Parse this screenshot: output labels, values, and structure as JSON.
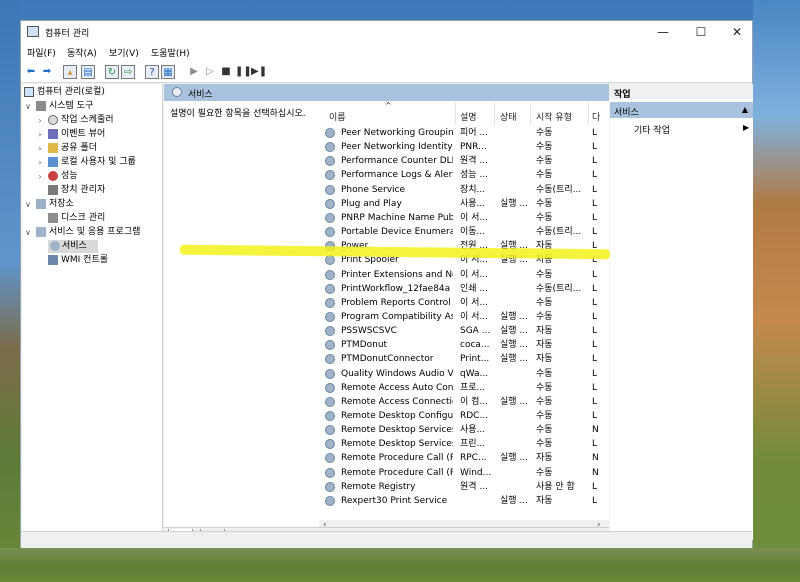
{
  "window": {
    "title": "컴퓨터 관리"
  },
  "menu": [
    "파일(F)",
    "동작(A)",
    "보기(V)",
    "도움말(H)"
  ],
  "tree": [
    {
      "label": "컴퓨터 관리(로컬)",
      "level": 0,
      "tw": ""
    },
    {
      "label": "시스템 도구",
      "level": 1,
      "tw": "∨"
    },
    {
      "label": "작업 스케줄러",
      "level": 2,
      "tw": "›"
    },
    {
      "label": "이벤트 뷰어",
      "level": 2,
      "tw": "›"
    },
    {
      "label": "공유 폴더",
      "level": 2,
      "tw": "›"
    },
    {
      "label": "로컬 사용자 및 그룹",
      "level": 2,
      "tw": "›"
    },
    {
      "label": "성능",
      "level": 2,
      "tw": "›"
    },
    {
      "label": "장치 관리자",
      "level": 2,
      "tw": ""
    },
    {
      "label": "저장소",
      "level": 1,
      "tw": "∨"
    },
    {
      "label": "디스크 관리",
      "level": 2,
      "tw": ""
    },
    {
      "label": "서비스 및 응용 프로그램",
      "level": 1,
      "tw": "∨"
    },
    {
      "label": "서비스",
      "level": 2,
      "tw": "",
      "selected": true
    },
    {
      "label": "WMI 컨트롤",
      "level": 2,
      "tw": ""
    }
  ],
  "services_header": "서비스",
  "description_text": "설명이 필요한 항목을 선택하십시오.",
  "columns": [
    "이름",
    "설명",
    "상태",
    "시작 유형",
    "다"
  ],
  "rows": [
    [
      "Peer Networking Grouping",
      "피어 ...",
      "",
      "수동",
      "L"
    ],
    [
      "Peer Networking Identity ...",
      "PNR...",
      "",
      "수동",
      "L"
    ],
    [
      "Performance Counter DLL ...",
      "원격 ...",
      "",
      "수동",
      "L"
    ],
    [
      "Performance Logs & Alerts",
      "성능 ...",
      "",
      "수동",
      "L"
    ],
    [
      "Phone Service",
      "장치...",
      "",
      "수동(트리...",
      "L"
    ],
    [
      "Plug and Play",
      "사용...",
      "실행 ...",
      "수동",
      "L"
    ],
    [
      "PNRP Machine Name Publi...",
      "이 서...",
      "",
      "수동",
      "L"
    ],
    [
      "Portable Device Enumerato...",
      "이동...",
      "",
      "수동(트리...",
      "L"
    ],
    [
      "Power",
      "전원 ...",
      "실행 ...",
      "자동",
      "L"
    ],
    [
      "Print Spooler",
      "이 서...",
      "실행 ...",
      "자동",
      "L"
    ],
    [
      "Printer Extensions and Noti...",
      "이 서...",
      "",
      "수동",
      "L"
    ],
    [
      "PrintWorkflow_12fae84a",
      "인쇄 ...",
      "",
      "수동(트리...",
      "L"
    ],
    [
      "Problem Reports Control P...",
      "이 서...",
      "",
      "수동",
      "L"
    ],
    [
      "Program Compatibility Assi...",
      "이 서...",
      "실행 ...",
      "수동",
      "L"
    ],
    [
      "PSSWSCSVC",
      "SGA ...",
      "실행 ...",
      "자동",
      "L"
    ],
    [
      "PTMDonut",
      "coca...",
      "실행 ...",
      "자동",
      "L"
    ],
    [
      "PTMDonutConnector",
      "Print...",
      "실행 ...",
      "자동",
      "L"
    ],
    [
      "Quality Windows Audio Vi...",
      "qWa...",
      "",
      "수동",
      "L"
    ],
    [
      "Remote Access Auto Conn...",
      "프로...",
      "",
      "수동",
      "L"
    ],
    [
      "Remote Access Connection...",
      "이 컴...",
      "실행 ...",
      "수동",
      "L"
    ],
    [
      "Remote Desktop Configura...",
      "RDC...",
      "",
      "수동",
      "L"
    ],
    [
      "Remote Desktop Services",
      "사용...",
      "",
      "수동",
      "N"
    ],
    [
      "Remote Desktop Services ...",
      "프린...",
      "",
      "수동",
      "L"
    ],
    [
      "Remote Procedure Call (RP...",
      "RPC...",
      "실행 ...",
      "자동",
      "N"
    ],
    [
      "Remote Procedure Call (RP...",
      "Wind...",
      "",
      "수동",
      "N"
    ],
    [
      "Remote Registry",
      "원격 ...",
      "",
      "사용 안 함",
      "L"
    ],
    [
      "Rexpert30 Print Service",
      "",
      "실행 ...",
      "자동",
      "L"
    ]
  ],
  "bottom_tabs": [
    "확장",
    "표준"
  ],
  "actions": {
    "header": "작업",
    "section": "서비스",
    "item": "기타 작업"
  },
  "colors": {
    "highlight": "#f2f21a",
    "section_bg": "#a9c3de"
  }
}
